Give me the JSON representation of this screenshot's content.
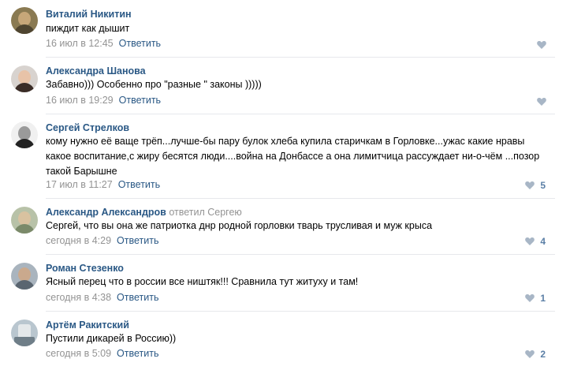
{
  "comments": [
    {
      "author": "Виталий Никитин",
      "reply_to": "",
      "text": "пиждит как дышит",
      "date": "16 июл в 12:45",
      "reply_label": "Ответить",
      "likes": ""
    },
    {
      "author": "Александра Шанова",
      "reply_to": "",
      "text": "Забавно))) Особенно про \"разные \" законы )))))",
      "date": "16 июл в 19:29",
      "reply_label": "Ответить",
      "likes": ""
    },
    {
      "author": "Сергей Стрелков",
      "reply_to": "",
      "text": "кому нужно её ваще трёп...лучше-бы пару булок хлеба купила старичкам в Горловке...ужас какие нравы какое воспитание,с жиру бесятся люди....война на Донбассе а она лимитчица рассуждает ни-о-чём ...позор такой Барышне",
      "date": "17 июл в 11:27",
      "reply_label": "Ответить",
      "likes": "5"
    },
    {
      "author": "Александр Александров",
      "reply_to": "ответил Сергею",
      "text": "Сергей, что вы она же патриотка днр родной горловки тварь трусливая и муж крыса",
      "date": "сегодня в 4:29",
      "reply_label": "Ответить",
      "likes": "4"
    },
    {
      "author": "Роман Стезенко",
      "reply_to": "",
      "text": "Ясный перец что в россии все ништяк!!! Сравнила тут житуху и там!",
      "date": "сегодня в 4:38",
      "reply_label": "Ответить",
      "likes": "1"
    },
    {
      "author": "Артём Ракитский",
      "reply_to": "",
      "text": "Пустили дикарей в Россию))",
      "date": "сегодня в 5:09",
      "reply_label": "Ответить",
      "likes": "2"
    }
  ],
  "colors": {
    "author": "#2a5885",
    "meta": "#939393",
    "like_icon": "#a8b6c6",
    "like_count": "#5b7fa6",
    "divider": "#e7e8ec"
  }
}
